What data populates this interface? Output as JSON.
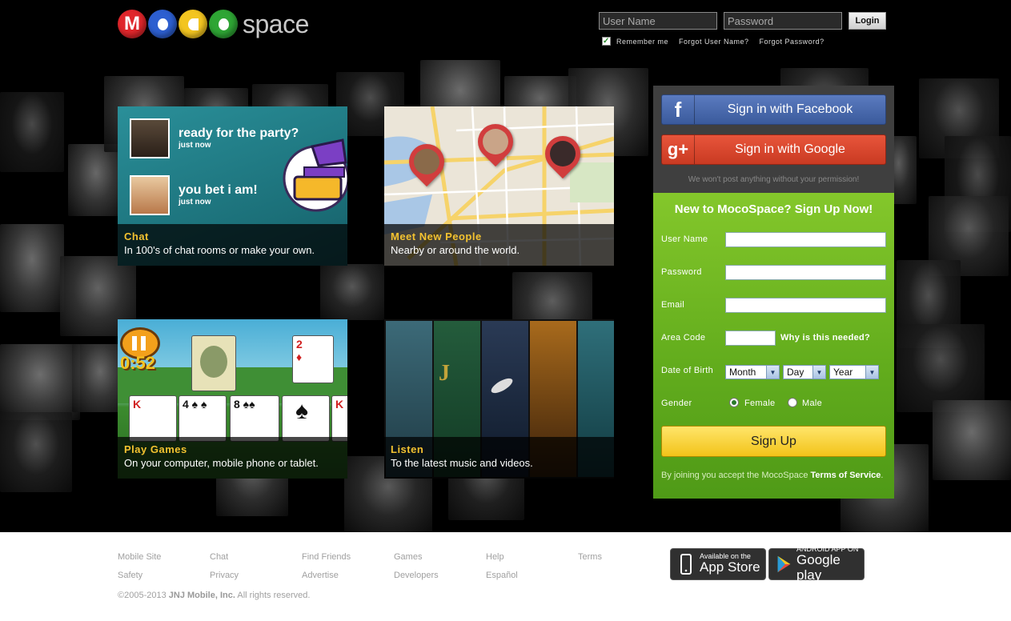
{
  "header": {
    "logo_word": "space",
    "username_placeholder": "User Name",
    "password_placeholder": "Password",
    "login_label": "Login",
    "remember_label": "Remember me",
    "forgot_user": "Forgot User Name?",
    "forgot_pass": "Forgot Password?"
  },
  "tiles": {
    "chat": {
      "title": "Chat",
      "subtitle": "In 100's of chat rooms or make your own.",
      "msg1": "ready for the party?",
      "msg1_time": "just now",
      "msg2": "you bet i am!",
      "msg2_time": "just now"
    },
    "people": {
      "title": "Meet New People",
      "subtitle": "Nearby or around the world."
    },
    "games": {
      "title": "Play Games",
      "subtitle": "On your computer, mobile phone or tablet.",
      "timer": "0:52"
    },
    "listen": {
      "title": "Listen",
      "subtitle": "To the latest music and videos."
    }
  },
  "social": {
    "facebook_label": "Sign in with Facebook",
    "google_label": "Sign in with Google",
    "permission_note": "We won't post anything without your permission!"
  },
  "signup": {
    "title": "New to MocoSpace? Sign Up Now!",
    "username_label": "User Name",
    "password_label": "Password",
    "email_label": "Email",
    "area_code_label": "Area Code",
    "why_needed": "Why is this needed?",
    "dob_label": "Date of Birth",
    "month": "Month",
    "day": "Day",
    "year": "Year",
    "gender_label": "Gender",
    "female": "Female",
    "male": "Male",
    "button": "Sign Up",
    "terms_prefix": "By joining you accept the MocoSpace",
    "terms_link": "Terms of Service"
  },
  "footer": {
    "links": {
      "mobile_site": "Mobile Site",
      "chat": "Chat",
      "find_friends": "Find Friends",
      "games": "Games",
      "help": "Help",
      "terms": "Terms",
      "safety": "Safety",
      "privacy": "Privacy",
      "advertise": "Advertise",
      "developers": "Developers",
      "espanol": "Español"
    },
    "copyright_prefix": "©2005-2013",
    "company": "JNJ Mobile, Inc.",
    "copyright_suffix": "All rights reserved.",
    "appstore_small": "Available on the",
    "appstore_big": "App Store",
    "gplay_small": "ANDROID APP ON",
    "gplay_big": "Google play"
  },
  "colors": {
    "accent_green": "#6cb521",
    "caption_yellow": "#f3c230",
    "facebook_blue": "#3a5a9c",
    "google_red": "#c93a22",
    "button_yellow": "#f2c319"
  }
}
